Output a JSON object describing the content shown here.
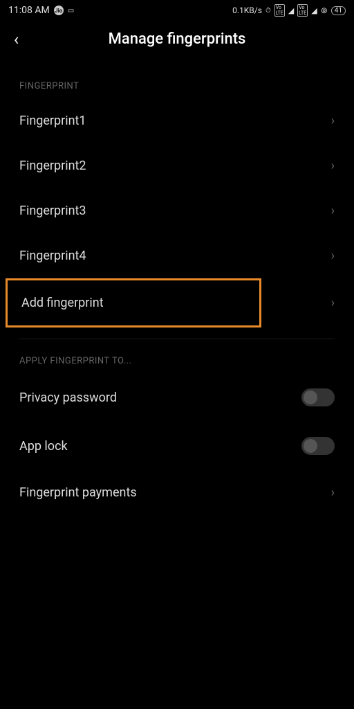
{
  "statusBar": {
    "time": "11:08 AM",
    "dataRate": "0.1KB/s",
    "battery": "41"
  },
  "header": {
    "title": "Manage fingerprints"
  },
  "sections": {
    "fingerprint": {
      "header": "FINGERPRINT",
      "items": [
        {
          "label": "Fingerprint1"
        },
        {
          "label": "Fingerprint2"
        },
        {
          "label": "Fingerprint3"
        },
        {
          "label": "Fingerprint4"
        }
      ],
      "addLabel": "Add fingerprint"
    },
    "applyTo": {
      "header": "APPLY FINGERPRINT TO...",
      "privacyPassword": {
        "label": "Privacy password",
        "enabled": false
      },
      "appLock": {
        "label": "App lock",
        "enabled": false
      },
      "payments": {
        "label": "Fingerprint payments"
      }
    }
  }
}
